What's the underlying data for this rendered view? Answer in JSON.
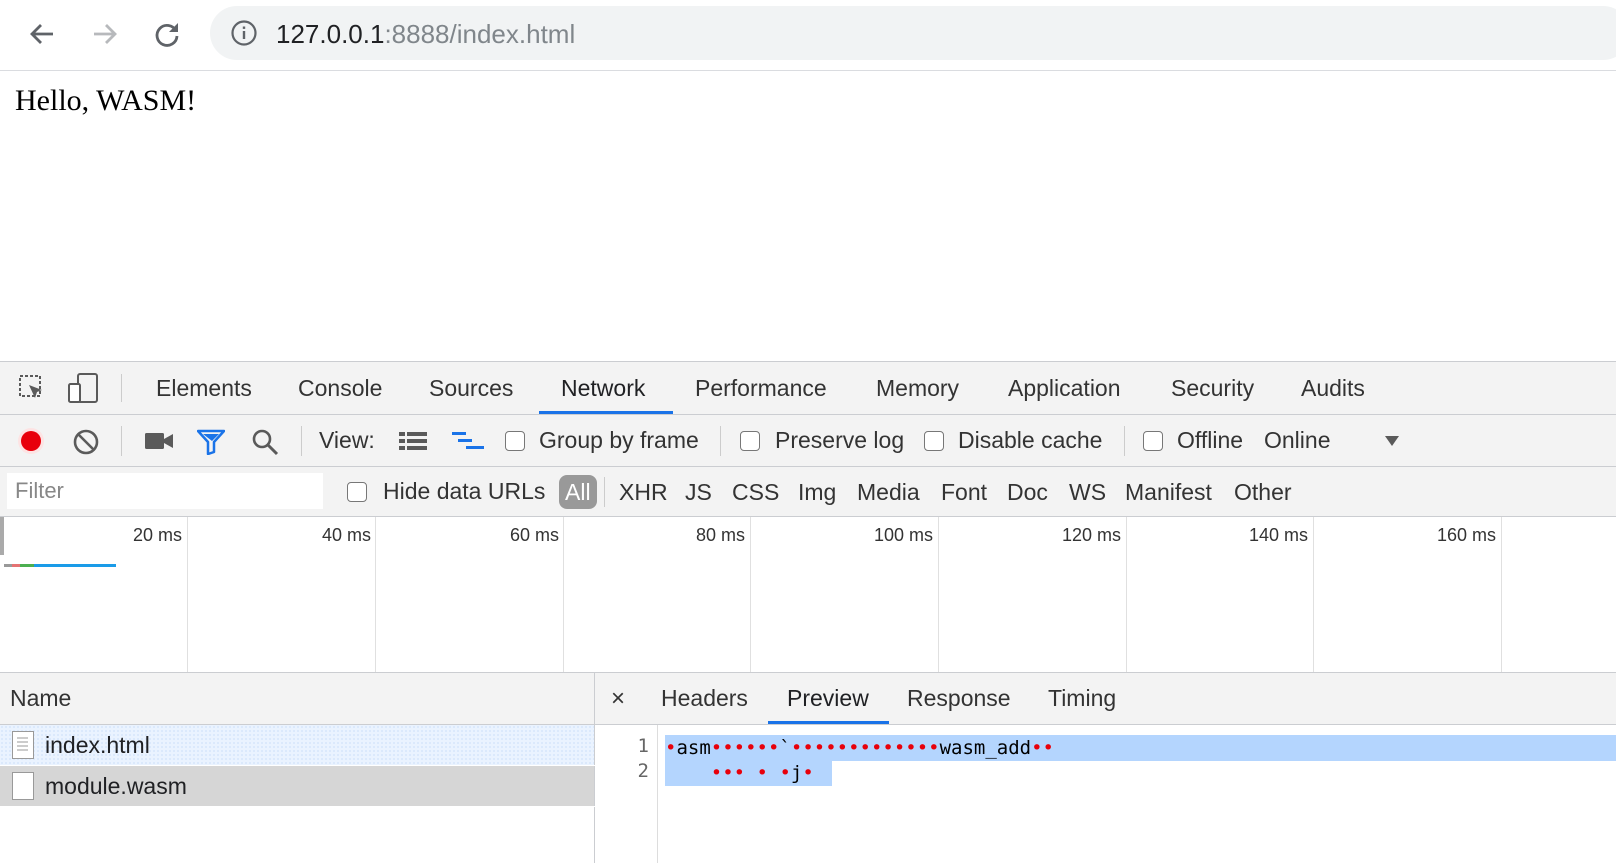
{
  "browser": {
    "url_host": "127.0.0.1",
    "url_rest": ":8888/index.html",
    "icons": [
      "back-arrow-icon",
      "forward-arrow-icon",
      "reload-icon",
      "info-icon"
    ]
  },
  "page": {
    "heading": "Hello, WASM!"
  },
  "devtools": {
    "tabs": [
      "Elements",
      "Console",
      "Sources",
      "Network",
      "Performance",
      "Memory",
      "Application",
      "Security",
      "Audits"
    ],
    "active_tab": "Network",
    "toolbar": {
      "view_label": "View:",
      "group_by_frame": "Group by frame",
      "preserve_log": "Preserve log",
      "disable_cache": "Disable cache",
      "offline": "Offline",
      "throttling": "Online"
    },
    "filter": {
      "placeholder": "Filter",
      "hide_data_urls": "Hide data URLs",
      "types": [
        "All",
        "XHR",
        "JS",
        "CSS",
        "Img",
        "Media",
        "Font",
        "Doc",
        "WS",
        "Manifest",
        "Other"
      ],
      "active_type": "All"
    },
    "timeline": {
      "ticks": [
        "20 ms",
        "40 ms",
        "60 ms",
        "80 ms",
        "100 ms",
        "120 ms",
        "140 ms",
        "160 ms"
      ]
    },
    "requests": {
      "header": "Name",
      "items": [
        "index.html",
        "module.wasm"
      ],
      "selected": "module.wasm"
    },
    "detail": {
      "close": "×",
      "tabs": [
        "Headers",
        "Preview",
        "Response",
        "Timing"
      ],
      "active_tab": "Preview",
      "line_numbers": [
        "1",
        "2"
      ],
      "line1_parts": [
        "asm",
        "`",
        "wasm_add",
        "j"
      ]
    },
    "colors": {
      "accent": "#1a73e8",
      "record": "#e8000b",
      "selection": "#b4d5fe",
      "filter_icon": "#1a73e8"
    }
  }
}
